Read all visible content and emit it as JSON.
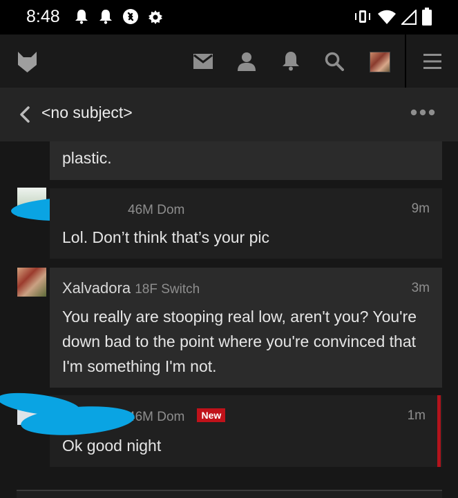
{
  "status_bar": {
    "time": "8:48",
    "icons": [
      "bell-icon",
      "bell-icon",
      "shazam-icon",
      "gear-icon",
      "vibrate-icon",
      "wifi-icon",
      "signal-icon",
      "battery-icon"
    ]
  },
  "nav": {
    "icons": [
      "logo-icon",
      "mail-icon",
      "user-icon",
      "bell-icon",
      "search-icon",
      "avatar",
      "menu-icon"
    ]
  },
  "thread": {
    "title": "<no subject>"
  },
  "messages": [
    {
      "sender": "",
      "meta": "",
      "time": "",
      "body": "plastic."
    },
    {
      "sender": "",
      "meta": "46M Dom",
      "time": "9m",
      "body": "Lol. Don’t think that’s your pic"
    },
    {
      "sender": "Xalvadora",
      "meta": "18F Switch",
      "time": "3m",
      "body": "You really are stooping real low, aren't you? You're down bad to the point where you're convinced that I'm something I'm not."
    },
    {
      "sender": "",
      "meta": "46M Dom",
      "badge": "New",
      "time": "1m",
      "body": "Ok good night"
    }
  ],
  "colors": {
    "accent_red": "#c0121a",
    "scribble_blue": "#0aa4e3",
    "background": "#171717"
  }
}
